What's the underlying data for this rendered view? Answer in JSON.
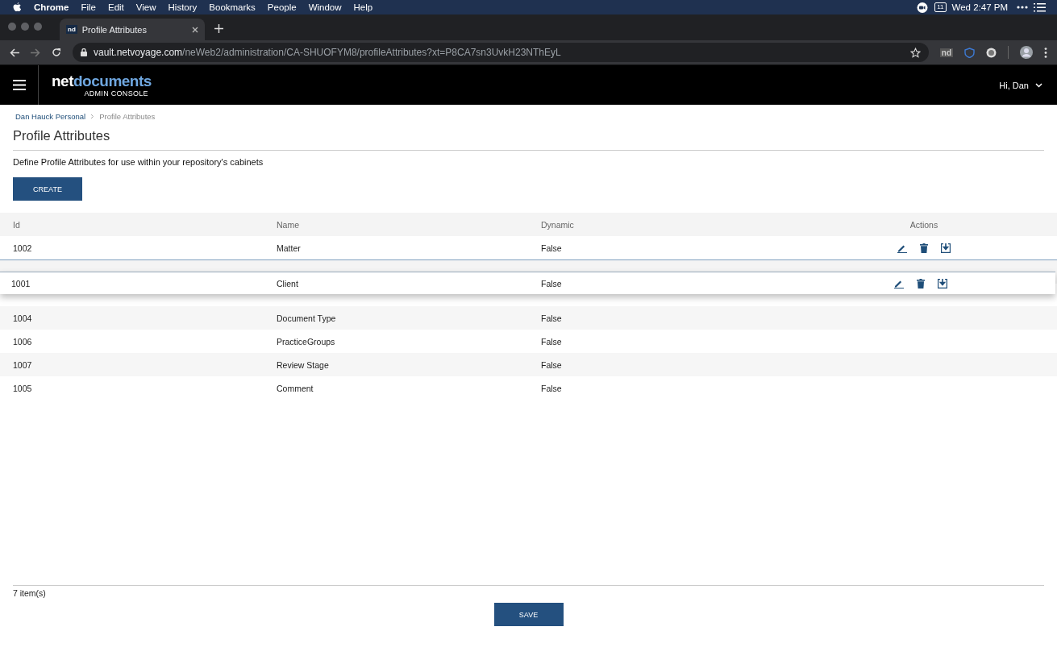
{
  "menu_bar": {
    "app": "Chrome",
    "items": [
      "File",
      "Edit",
      "View",
      "History",
      "Bookmarks",
      "People",
      "Window",
      "Help"
    ],
    "calendar_day": "11",
    "clock": "Wed 2:47 PM"
  },
  "browser": {
    "tab": {
      "favicon": "nd",
      "title": "Profile Attributes"
    },
    "url_host": "vault.netvoyage.com",
    "url_path": "/neWeb2/administration/CA-SHUOFYM8/profileAttributes?xt=P8CA7sn3UvkH23NThEyL",
    "extension": "nd"
  },
  "header": {
    "logo_first": "net",
    "logo_second": "documents",
    "logo_sub": "ADMIN CONSOLE",
    "user": "Hi, Dan"
  },
  "breadcrumb": [
    "Dan Hauck Personal",
    "Profile Attributes"
  ],
  "title": "Profile Attributes",
  "description": "Define Profile Attributes for use within your repository's cabinets",
  "create_button": "CREATE",
  "table": {
    "columns": [
      "Id",
      "Name",
      "Dynamic",
      "Actions"
    ],
    "rows": [
      {
        "id": "1002",
        "name": "Matter",
        "dynamic": "False",
        "hovered": true
      },
      {
        "id": "1004",
        "name": "Document Type",
        "dynamic": "False",
        "hovered": false
      },
      {
        "id": "1006",
        "name": "PracticeGroups",
        "dynamic": "False",
        "hovered": false
      },
      {
        "id": "1007",
        "name": "Review Stage",
        "dynamic": "False",
        "hovered": false
      },
      {
        "id": "1005",
        "name": "Comment",
        "dynamic": "False",
        "hovered": false
      }
    ],
    "dragged_row": {
      "id": "1001",
      "name": "Client",
      "dynamic": "False"
    }
  },
  "item_count": "7 item(s)",
  "save_button": "SAVE"
}
